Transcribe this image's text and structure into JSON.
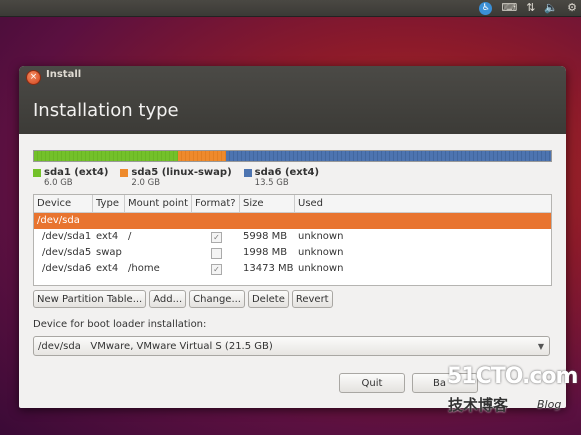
{
  "tray": {
    "keyboard": "⌨",
    "network": "⇅",
    "volume": "🔈",
    "settings": "⚙"
  },
  "window": {
    "title": "Install",
    "heading": "Installation type"
  },
  "partitions": [
    {
      "name": "sda1 (ext4)",
      "size": "6.0 GB",
      "color": "#73c12a",
      "fraction": 0.279
    },
    {
      "name": "sda5 (linux-swap)",
      "size": "2.0 GB",
      "color": "#ee8a2c",
      "fraction": 0.093
    },
    {
      "name": "sda6 (ext4)",
      "size": "13.5 GB",
      "color": "#4d74b0",
      "fraction": 0.628
    }
  ],
  "table": {
    "headers": [
      "Device",
      "Type",
      "Mount point",
      "Format?",
      "Size",
      "Used"
    ],
    "selected_row": "/dev/sda",
    "rows": [
      {
        "device": "/dev/sda1",
        "type": "ext4",
        "mount": "/",
        "format": true,
        "size": "5998 MB",
        "used": "unknown"
      },
      {
        "device": "/dev/sda5",
        "type": "swap",
        "mount": "",
        "format": false,
        "size": "1998 MB",
        "used": "unknown"
      },
      {
        "device": "/dev/sda6",
        "type": "ext4",
        "mount": "/home",
        "format": true,
        "size": "13473 MB",
        "used": "unknown"
      }
    ]
  },
  "buttons": {
    "new_table": "New Partition Table...",
    "add": "Add...",
    "change": "Change...",
    "delete": "Delete",
    "revert": "Revert"
  },
  "boot_loader": {
    "label": "Device for boot loader installation:",
    "value": "/dev/sda   VMware, VMware Virtual S (21.5 GB)"
  },
  "nav": {
    "quit": "Quit",
    "back": "Ba"
  },
  "watermark": {
    "main": "51CTO.com",
    "sub": "技术博客",
    "blog": "Blog"
  }
}
